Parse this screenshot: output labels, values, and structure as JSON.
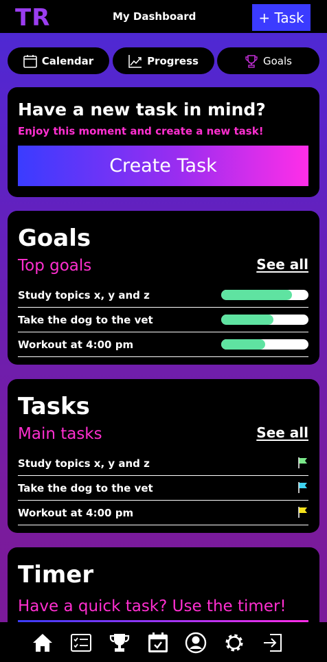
{
  "header": {
    "logo": "TR",
    "title": "My Dashboard",
    "add_task_label": "+ Task"
  },
  "nav_pills": [
    {
      "label": "Calendar",
      "icon": "calendar-icon"
    },
    {
      "label": "Progress",
      "icon": "chart-line-icon"
    },
    {
      "label": "Goals",
      "icon": "trophy-icon"
    }
  ],
  "new_task": {
    "title": "Have a new task in mind?",
    "subtitle": "Enjoy this moment and create a new task!",
    "button_label": "Create Task"
  },
  "goals": {
    "title": "Goals",
    "subtitle": "Top goals",
    "see_all": "See all",
    "items": [
      {
        "label": "Study topics x, y and z",
        "progress": 0.81
      },
      {
        "label": "Take the dog to the vet",
        "progress": 0.6
      },
      {
        "label": "Workout at 4:00 pm",
        "progress": 0.5
      }
    ]
  },
  "tasks": {
    "title": "Tasks",
    "subtitle": "Main tasks",
    "see_all": "See all",
    "items": [
      {
        "label": "Study topics x, y and z",
        "flag_color": "#7be88a"
      },
      {
        "label": "Take the dog to the vet",
        "flag_color": "#3fd3f0"
      },
      {
        "label": "Workout at 4:00 pm",
        "flag_color": "#f5e21c"
      }
    ]
  },
  "timer": {
    "title": "Timer",
    "subtitle": "Have a quick task? Use the timer!"
  },
  "bottom_nav": [
    {
      "icon": "home-icon"
    },
    {
      "icon": "task-list-icon"
    },
    {
      "icon": "trophy-icon"
    },
    {
      "icon": "calendar-check-icon"
    },
    {
      "icon": "profile-icon"
    },
    {
      "icon": "settings-icon"
    },
    {
      "icon": "logout-icon"
    }
  ],
  "colors": {
    "accent": "#ff2fd0",
    "brand": "#9b3df0",
    "button": "#3b3bff",
    "progress": "#5fe3a1"
  }
}
